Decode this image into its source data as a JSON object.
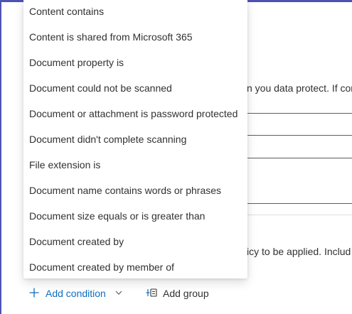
{
  "background": {
    "description_text": "n you data protect. If cor",
    "apply_text": "icy to be applied. Includ"
  },
  "menu": {
    "items": [
      "Content contains",
      "Content is shared from Microsoft 365",
      "Document property is",
      "Document could not be scanned",
      "Document or attachment is password protected",
      "Document didn't complete scanning",
      "File extension is",
      "Document name contains words or phrases",
      "Document size equals or is greater than",
      "Document created by",
      "Document created by member of"
    ]
  },
  "actions": {
    "add_condition_label": "Add condition",
    "add_group_label": "Add group"
  },
  "icons": {
    "add": "plus-icon",
    "chevron": "chevron-down-icon",
    "group": "add-group-icon"
  },
  "colors": {
    "accent": "#4f52b2",
    "link": "#0f6cbd"
  }
}
